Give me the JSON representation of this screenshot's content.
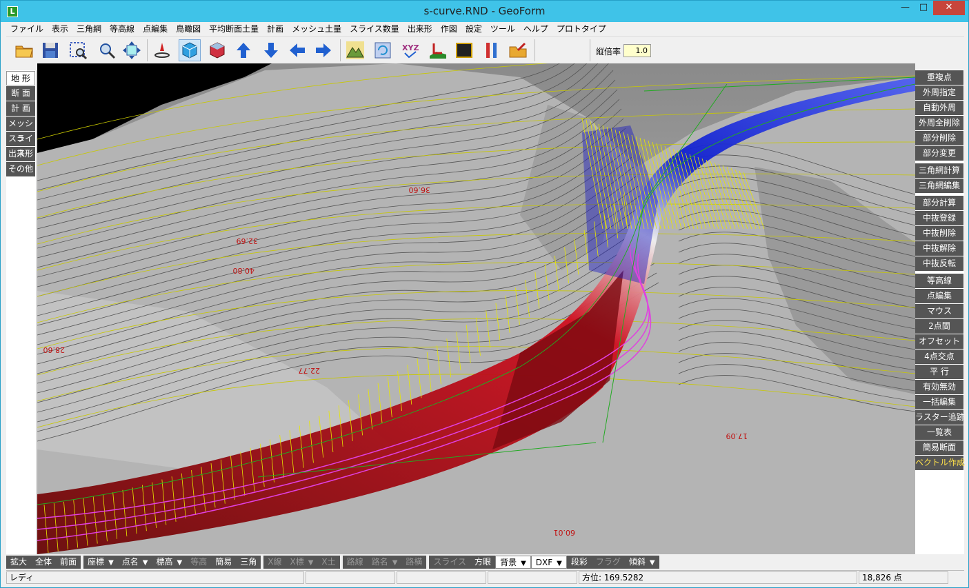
{
  "window": {
    "title": "s-curve.RND - GeoForm",
    "app_icon": "L",
    "controls": {
      "minimize": "—",
      "maximize": "□",
      "close": "✕"
    }
  },
  "menu": [
    "ファイル",
    "表示",
    "三角網",
    "等高線",
    "点編集",
    "鳥瞰図",
    "平均断面土量",
    "計画",
    "メッシュ土量",
    "スライス数量",
    "出来形",
    "作図",
    "設定",
    "ツール",
    "ヘルプ",
    "プロトタイプ"
  ],
  "toolbar": {
    "icons": [
      "open-folder-icon",
      "save-icon",
      "zoom-window-icon",
      "zoom-icon",
      "pan-move-icon",
      "point-edit-icon",
      "3d-box-icon",
      "3d-box-red-icon",
      "arrow-up-icon",
      "arrow-down-icon",
      "arrow-left-icon",
      "arrow-right-icon",
      "terrain-icon",
      "rotate-view-icon",
      "xyz-icon",
      "section-icon",
      "frame-icon",
      "tools-icon",
      "export-icon"
    ],
    "scale_label": "縦倍率",
    "scale_value": "1.0"
  },
  "left_panel": {
    "items": [
      "地 形",
      "断 面",
      "計 画",
      "メッシュ",
      "スライス",
      "出来形",
      "その他"
    ],
    "active_index": 0
  },
  "right_panel": {
    "groups": [
      [
        "重複点",
        "外周指定",
        "自動外周",
        "外周全削除",
        "部分削除",
        "部分変更"
      ],
      [
        "三角網計算",
        "三角網編集"
      ],
      [
        "部分計算",
        "中抜登録",
        "中抜削除",
        "中抜解除",
        "中抜反転"
      ],
      [
        "等高線",
        "点編集",
        "マウス",
        "2点間",
        "オフセット",
        "4点交点",
        "平 行",
        "有効無効",
        "一括編集",
        "ラスター追跡",
        "一覧表",
        "簡易断面",
        "ベクトル作成"
      ]
    ],
    "highlight_label": "ベクトル作成"
  },
  "viewport": {
    "labels": [
      "28.60",
      "32.69",
      "40.80",
      "22.77",
      "17.09",
      "36.60",
      "60.01"
    ],
    "colors": {
      "road_red": "#c0101a",
      "road_blue": "#1a1ad0",
      "contour_yellow": "#d8d800",
      "slope_magenta": "#e040e0",
      "terrain_gray": "#b8b8b8"
    }
  },
  "bottom_bar": [
    {
      "label": "拡大"
    },
    {
      "label": "全体"
    },
    {
      "label": "前面"
    },
    {
      "label": "座標",
      "dropdown": true
    },
    {
      "label": "点名",
      "dropdown": true
    },
    {
      "label": "標高",
      "dropdown": true
    },
    {
      "label": "等高",
      "disabled": true
    },
    {
      "label": "簡易"
    },
    {
      "label": "三角"
    },
    {
      "label": "X線",
      "disabled": true
    },
    {
      "label": "X標",
      "disabled": true,
      "dropdown": true
    },
    {
      "label": "X土",
      "disabled": true
    },
    {
      "label": "路線",
      "disabled": true
    },
    {
      "label": "路名",
      "disabled": true,
      "dropdown": true
    },
    {
      "label": "路横",
      "disabled": true
    },
    {
      "label": "スライス",
      "disabled": true
    },
    {
      "label": "方眼"
    },
    {
      "label": "背景",
      "white": true,
      "dropdown": true
    },
    {
      "label": "DXF",
      "white": true,
      "dropdown": true
    },
    {
      "label": "段彩"
    },
    {
      "label": "フラグ",
      "disabled": true
    },
    {
      "label": "傾斜",
      "dropdown": true
    }
  ],
  "status": {
    "ready": "レディ",
    "bearing": "方位: 169.5282",
    "point_count": "18,826 点"
  }
}
